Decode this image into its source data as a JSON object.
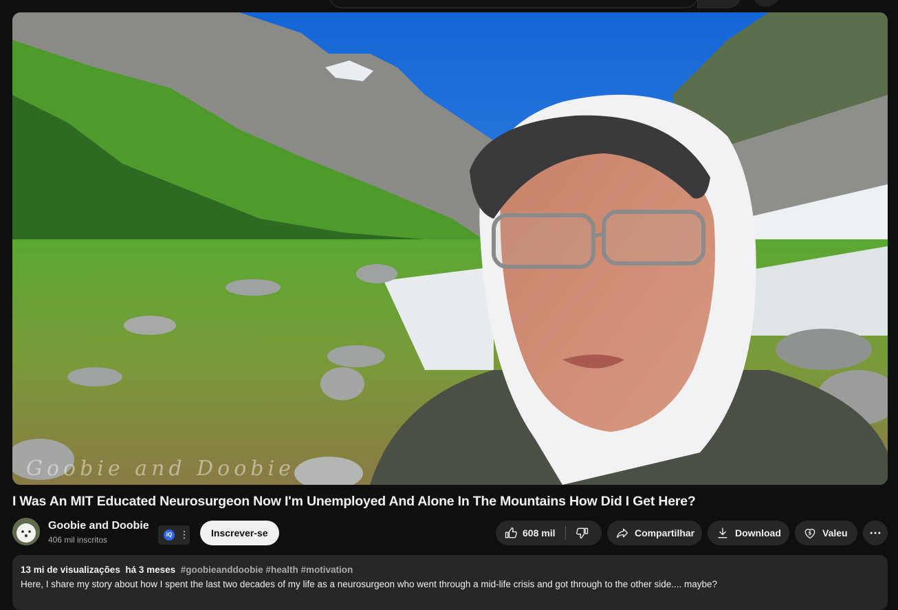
{
  "video": {
    "title": "I Was An MIT Educated Neurosurgeon Now I'm Unemployed And Alone In The Mountains How Did I Get Here?",
    "watermark": "Goobie and Doobie"
  },
  "channel": {
    "name": "Goobie and Doobie",
    "subscribers": "406 mil inscritos",
    "badge_icon": "iq-extension-icon"
  },
  "actions": {
    "subscribe_label": "Inscrever-se",
    "like_count": "608 mil",
    "share_label": "Compartilhar",
    "download_label": "Download",
    "thanks_label": "Valeu"
  },
  "description": {
    "views": "13 mi de visualizações",
    "date": "há 3 meses",
    "hashtags": "#goobieanddoobie #health #motivation",
    "text": "Here, I share my story about how I spent the last two decades of my life as a neurosurgeon who went through a mid-life crisis and got through to the other side.... maybe?"
  },
  "colors": {
    "background": "#0f0f0f",
    "pill": "#272727",
    "subscribe_bg": "#f1f1f1"
  }
}
